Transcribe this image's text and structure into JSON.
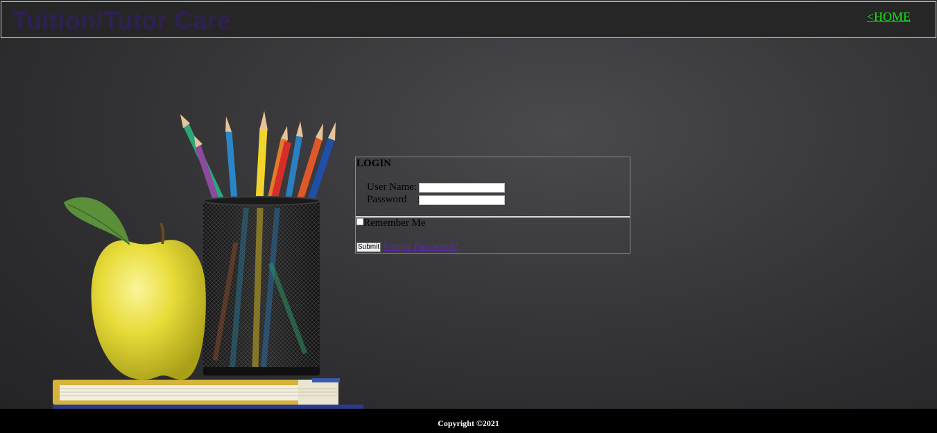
{
  "header": {
    "brand": "Tuition/Tutor Care",
    "home_link": "<HOME"
  },
  "login": {
    "title": "LOGIN",
    "username_label": "User Name:",
    "password_label": "Password    :",
    "remember_label": "Remember Me",
    "submit_label": "Submit",
    "forgot_label": "Forgot Password?"
  },
  "footer": {
    "copyright": "Copyright ©2021"
  },
  "colors": {
    "brand": "#2f1f52",
    "home_link": "#19e019",
    "forgot_link": "#5a2ca0",
    "footer_bg": "#000000"
  }
}
